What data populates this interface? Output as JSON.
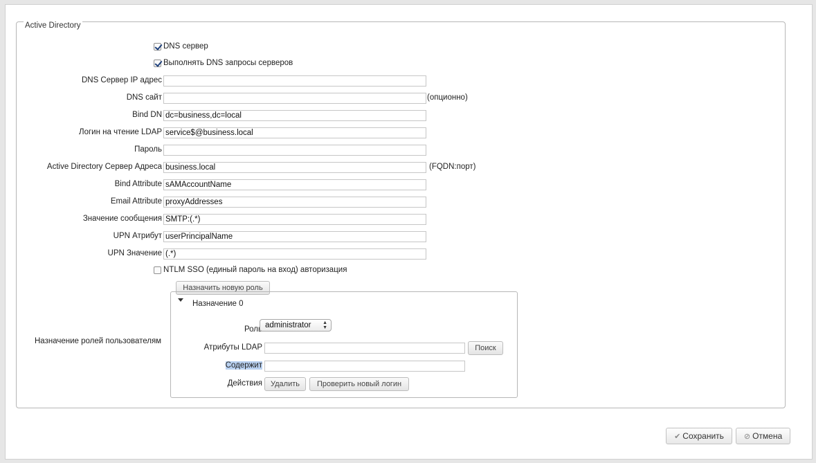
{
  "section": {
    "legend": "Active Directory"
  },
  "checkboxes": {
    "dns_server": {
      "label": "DNS сервер",
      "checked": true
    },
    "dns_queries": {
      "label": "Выполнять DNS запросы серверов",
      "checked": true
    },
    "ntlm_sso": {
      "label": "NTLM SSO (единый пароль на вход) авторизация",
      "checked": false
    }
  },
  "fields": {
    "dns_ip": {
      "label": "DNS Сервер IP адрес",
      "value": ""
    },
    "dns_site": {
      "label": "DNS сайт",
      "value": "",
      "hint": "(опционно)"
    },
    "bind_dn": {
      "label": "Bind DN",
      "value": "dc=business,dc=local"
    },
    "ldap_login": {
      "label": "Логин на чтение LDAP",
      "value": "service$@business.local"
    },
    "password": {
      "label": "Пароль",
      "value": ""
    },
    "ad_server": {
      "label": "Active Directory Сервер Адреса",
      "value": "business.local",
      "hint": "(FQDN:порт)"
    },
    "bind_attr": {
      "label": "Bind Attribute",
      "value": "sAMAccountName"
    },
    "email_attr": {
      "label": "Email Attribute",
      "value": "proxyAddresses"
    },
    "msg_value": {
      "label": "Значение сообщения",
      "value": "SMTP:(.*)"
    },
    "upn_attr": {
      "label": "UPN Атрибут",
      "value": "userPrincipalName"
    },
    "upn_value": {
      "label": "UPN Значение",
      "value": "(.*)"
    }
  },
  "roles": {
    "label": "Назначение ролей пользователям",
    "assign_button": "Назначить новую роль",
    "assignment_title": "Назначение 0",
    "role_label": "Роль",
    "role_value": "administrator",
    "ldap_attr_label": "Атрибуты LDAP",
    "ldap_attr_value": "",
    "search_button": "Поиск",
    "contains_label": "Содержит",
    "contains_value": "",
    "actions_label": "Действия",
    "delete_button": "Удалить",
    "check_login_button": "Проверить новый логин"
  },
  "footer": {
    "save_button": "Сохранить",
    "cancel_button": "Отмена"
  }
}
